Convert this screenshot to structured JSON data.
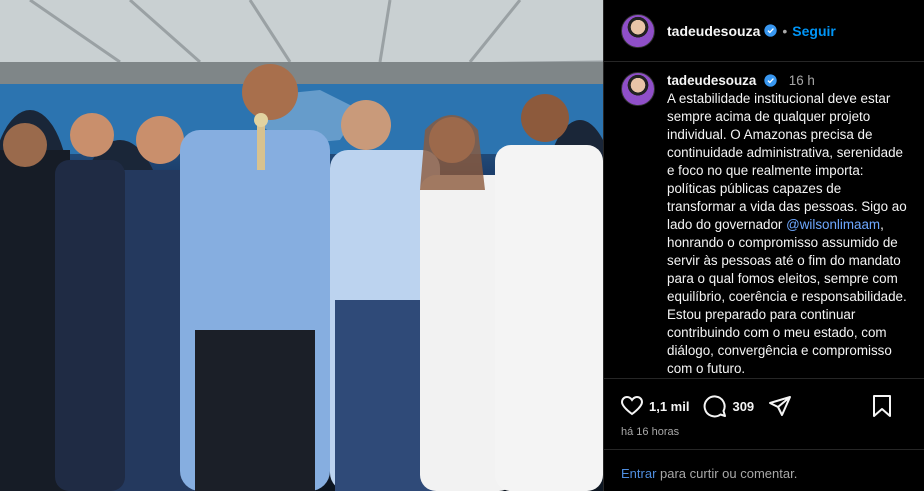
{
  "post": {
    "username": "tadeudesouza",
    "follow_label": "Seguir",
    "separator": "•",
    "time": "16 h",
    "caption_lines": "A estabilidade institucional deve estar sempre acima de qualquer projeto individual. O Amazonas precisa de continuidade administrativa, serenidade e foco no que realmente importa: políticas públicas capazes de transformar a vida das pessoas. Sigo ao lado do governador ",
    "mention": "@wilsonlimaam",
    "caption_end": ", honrando o compromisso assumido de servir às pessoas até o fim do mandato para o qual fomos eleitos, sempre com equilíbrio, coerência e responsabilidade. Estou preparado para continuar contribuindo com o meu estado, com diálogo, convergência e compromisso com o futuro.",
    "likes": "1,1 mil",
    "comments": "309",
    "posted_ago": "há 16 horas",
    "login_link": "Entrar",
    "login_text": " para curtir ou comentar."
  },
  "colors": {
    "accent": "#0095f6",
    "verified": "#3897f0",
    "background": "#000000"
  },
  "icons": [
    "verified-badge-icon",
    "heart-icon",
    "comment-icon",
    "share-icon",
    "bookmark-icon"
  ]
}
